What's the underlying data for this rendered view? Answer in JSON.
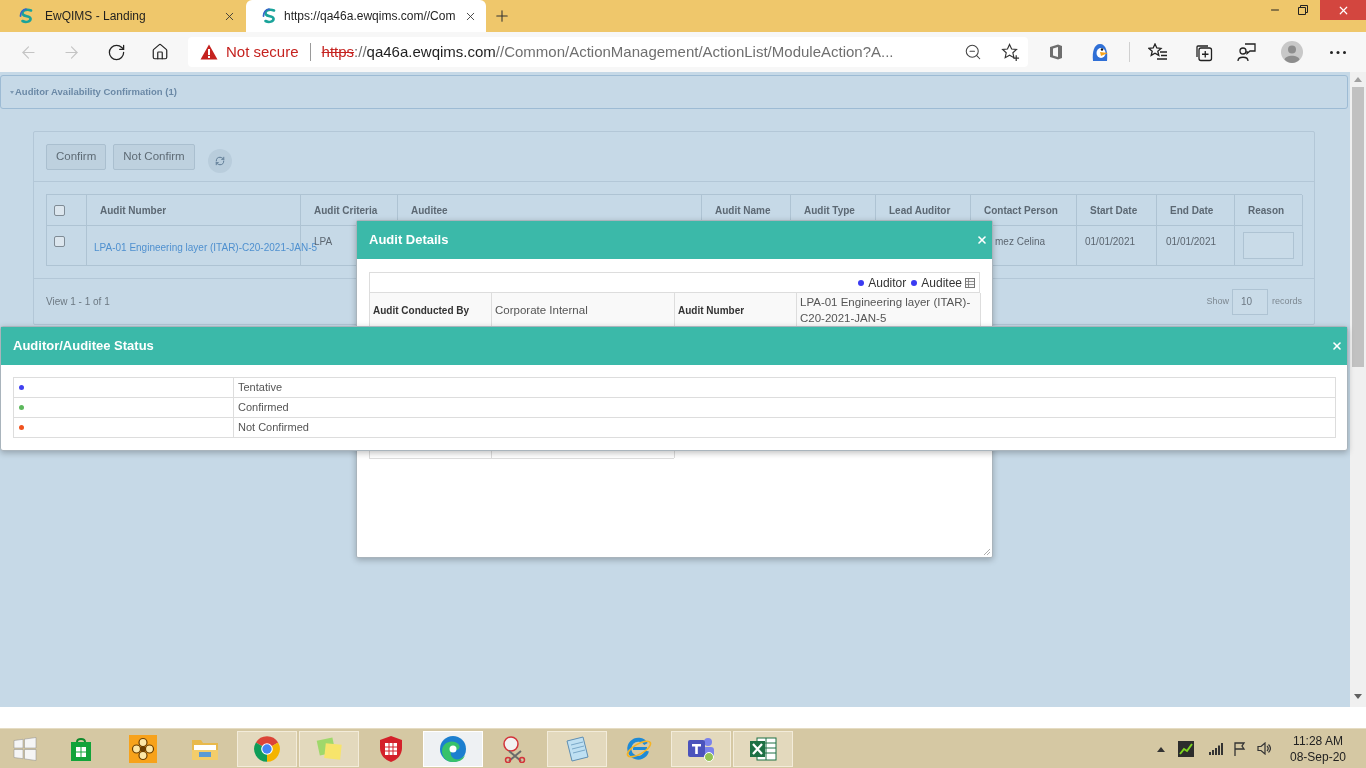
{
  "browser": {
    "tabs": [
      {
        "title": "EwQIMS - Landing",
        "selected": false
      },
      {
        "title": "https://qa46a.ewqims.com//Com",
        "selected": true
      }
    ],
    "navigation": {
      "back_disabled": true,
      "forward_disabled": true
    },
    "address": {
      "security": "Not secure",
      "scheme": "https",
      "separator": "://",
      "host": "qa46a.ewqims.com",
      "path": "//Common/ActionManagement/ActionList/ModuleAction?A..."
    }
  },
  "page": {
    "title": "Auditor Availability Confirmation (1)",
    "actions": [
      "Confirm",
      "Not Confirm"
    ],
    "table": {
      "select_all": {
        "checked": false
      },
      "columns": [
        "Audit Number",
        "Audit Criteria",
        "Auditee",
        "Audit Name",
        "Audit Type",
        "Lead Auditor",
        "Contact Person",
        "Start Date",
        "End Date",
        "Reason"
      ],
      "rows": [
        {
          "checked": false,
          "audit_number": "LPA-01 Engineering layer (ITAR)-C20-2021-JAN-5",
          "audit_criteria": "LPA",
          "contact_person": "mez Celina",
          "start_date": "01/01/2021",
          "end_date": "01/01/2021"
        }
      ]
    },
    "pager": {
      "summary": "View 1 - 1 of 1",
      "show": "Show",
      "page_size": "10",
      "records": "records"
    }
  },
  "audit_details": {
    "title": "Audit Details",
    "legend": [
      {
        "label": "Auditor",
        "color": "#3b3bf2"
      },
      {
        "label": "Auditee",
        "color": "#3b3bf2"
      }
    ],
    "fields": [
      {
        "label": "Audit Conducted By",
        "value": "Corporate Internal"
      },
      {
        "label": "Audit Number",
        "value": "LPA-01 Engineering layer (ITAR)-C20-2021-JAN-5"
      }
    ]
  },
  "status_dialog": {
    "title": "Auditor/Auditee Status",
    "statuses": [
      {
        "label": "Tentative",
        "color": "#4040f0"
      },
      {
        "label": "Confirmed",
        "color": "#5cb85c"
      },
      {
        "label": "Not Confirmed",
        "color": "#f0521e"
      }
    ]
  },
  "taskbar": {
    "apps": [
      {
        "kind": "store",
        "running": false,
        "selected": false
      },
      {
        "kind": "flower",
        "running": false,
        "selected": false
      },
      {
        "kind": "explorer",
        "running": false,
        "selected": false
      },
      {
        "kind": "chrome",
        "running": true,
        "selected": false
      },
      {
        "kind": "sticky",
        "running": true,
        "selected": false
      },
      {
        "kind": "shield",
        "running": false,
        "selected": false
      },
      {
        "kind": "edge",
        "running": true,
        "selected": true
      },
      {
        "kind": "snip",
        "running": false,
        "selected": false
      },
      {
        "kind": "notepad",
        "running": true,
        "selected": false
      },
      {
        "kind": "ie",
        "running": false,
        "selected": false
      },
      {
        "kind": "teams",
        "running": true,
        "selected": false
      },
      {
        "kind": "excel",
        "running": true,
        "selected": false
      }
    ],
    "clock": {
      "time": "11:28 AM",
      "date": "08-Sep-20"
    }
  }
}
